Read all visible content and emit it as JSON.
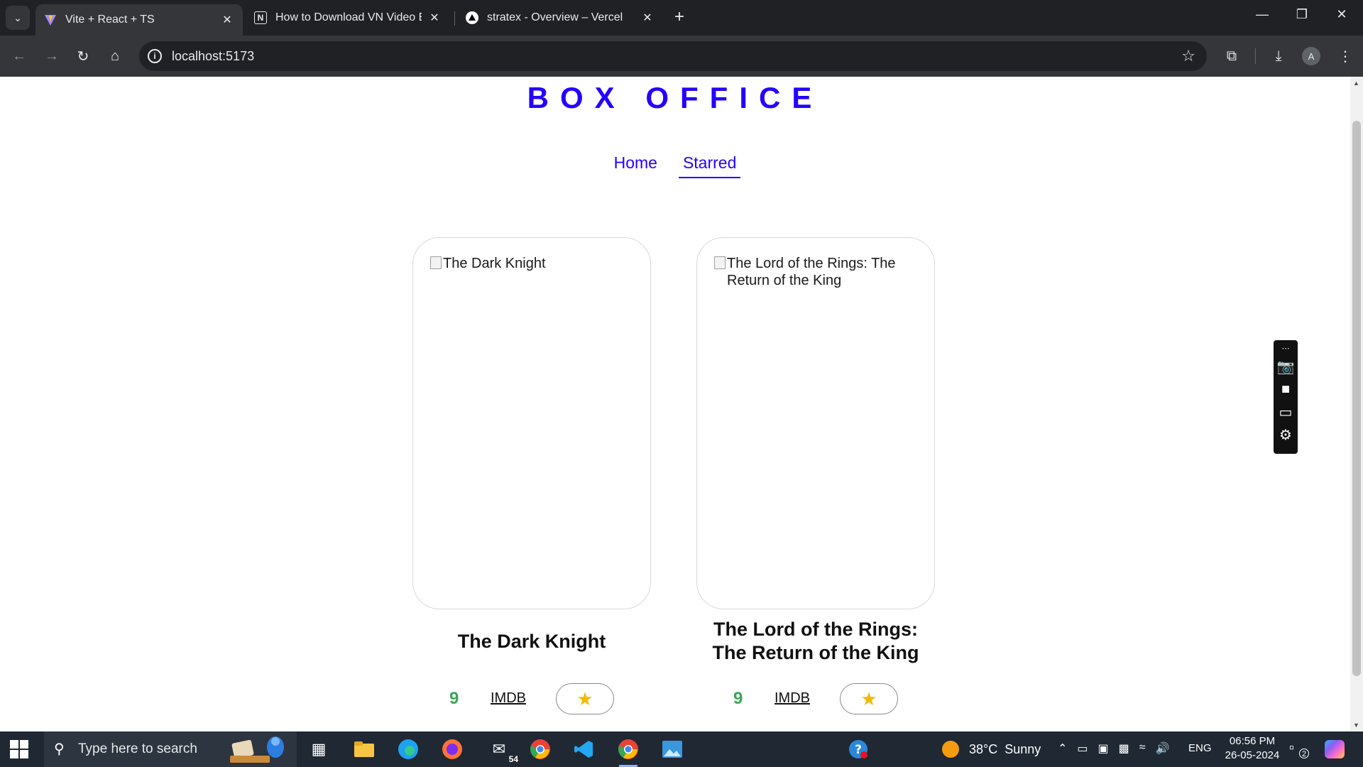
{
  "browser": {
    "tabs": [
      {
        "title": "Vite + React + TS",
        "active": true
      },
      {
        "title": "How to Download VN Video Ed",
        "active": false
      },
      {
        "title": "stratex - Overview – Vercel",
        "active": false
      }
    ],
    "url": "localhost:5173",
    "profile_initial": "A"
  },
  "page": {
    "brand": "BOX OFFICE",
    "nav": [
      {
        "label": "Home",
        "active": false
      },
      {
        "label": "Starred",
        "active": true
      }
    ],
    "cards": [
      {
        "image_alt": "The Dark Knight",
        "title": "The Dark Knight",
        "rating": "9",
        "link_label": "IMDB",
        "starred": true
      },
      {
        "image_alt": "The Lord of the Rings: The Return of the King",
        "title": "The Lord of the Rings: The Return of the King",
        "rating": "9",
        "link_label": "IMDB",
        "starred": true
      }
    ]
  },
  "colors": {
    "brand": "#2400ff",
    "rating": "#3aa657",
    "star": "#f5b800"
  },
  "taskbar": {
    "search_placeholder": "Type here to search",
    "mail_badge": "54",
    "weather": {
      "temp": "38°C",
      "condition": "Sunny"
    },
    "language": "ENG",
    "time": "06:56 PM",
    "date": "26-05-2024",
    "notifications": "2"
  }
}
